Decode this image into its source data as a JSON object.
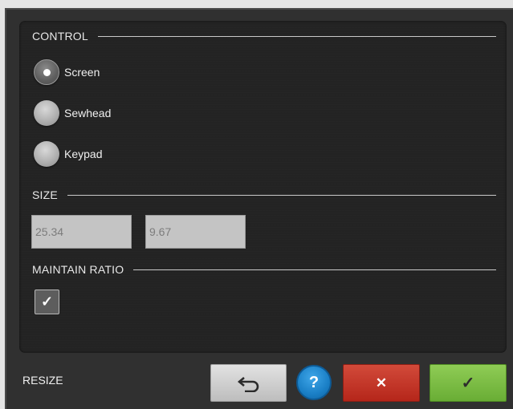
{
  "control": {
    "heading": "CONTROL",
    "options": [
      {
        "label": "Screen",
        "selected": true
      },
      {
        "label": "Sewhead",
        "selected": false
      },
      {
        "label": "Keypad",
        "selected": false
      }
    ]
  },
  "size": {
    "heading": "SIZE",
    "width_value": "25.34",
    "height_value": "9.67"
  },
  "ratio": {
    "heading": "MAINTAIN RATIO",
    "checked": true
  },
  "footer": {
    "title": "RESIZE",
    "help_label": "?",
    "icons": {
      "undo": "undo-arrow-icon",
      "help": "help-icon",
      "cancel": "cancel-x-icon",
      "confirm": "checkmark-icon"
    }
  },
  "colors": {
    "background": "#303030",
    "panel": "#232323",
    "cancel": "#c0392b",
    "confirm": "#7cbd45",
    "help": "#1a7fc6"
  }
}
